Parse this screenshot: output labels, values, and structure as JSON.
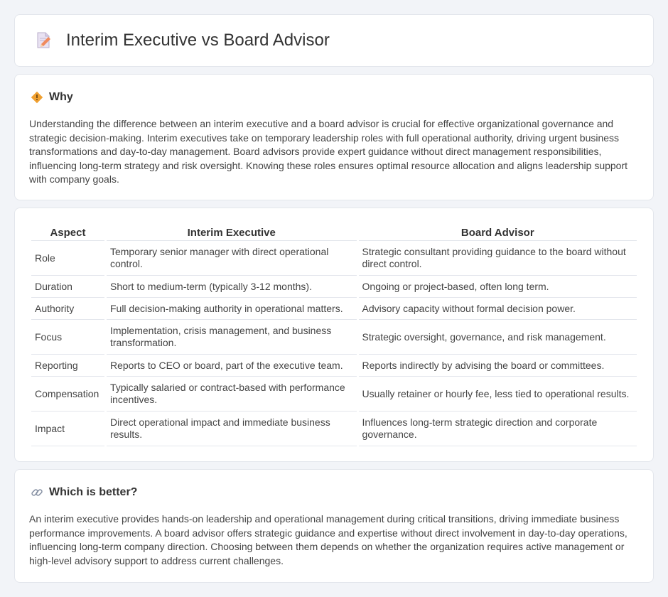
{
  "page": {
    "title": "Interim Executive vs Board Advisor",
    "title_icon": "document-pencil-icon"
  },
  "why": {
    "icon": "diamond-warning-icon",
    "title": "Why",
    "text": "Understanding the difference between an interim executive and a board advisor is crucial for effective organizational governance and strategic decision-making. Interim executives take on temporary leadership roles with full operational authority, driving urgent business transformations and day-to-day management. Board advisors provide expert guidance without direct management responsibilities, influencing long-term strategy and risk oversight. Knowing these roles ensures optimal resource allocation and aligns leadership support with company goals."
  },
  "comparison": {
    "headers": [
      "Aspect",
      "Interim Executive",
      "Board Advisor"
    ],
    "rows": [
      {
        "aspect": "Role",
        "interim": "Temporary senior manager with direct operational control.",
        "board": "Strategic consultant providing guidance to the board without direct control."
      },
      {
        "aspect": "Duration",
        "interim": "Short to medium-term (typically 3-12 months).",
        "board": "Ongoing or project-based, often long term."
      },
      {
        "aspect": "Authority",
        "interim": "Full decision-making authority in operational matters.",
        "board": "Advisory capacity without formal decision power."
      },
      {
        "aspect": "Focus",
        "interim": "Implementation, crisis management, and business transformation.",
        "board": "Strategic oversight, governance, and risk management."
      },
      {
        "aspect": "Reporting",
        "interim": "Reports to CEO or board, part of the executive team.",
        "board": "Reports indirectly by advising the board or committees."
      },
      {
        "aspect": "Compensation",
        "interim": "Typically salaried or contract-based with performance incentives.",
        "board": "Usually retainer or hourly fee, less tied to operational results."
      },
      {
        "aspect": "Impact",
        "interim": "Direct operational impact and immediate business results.",
        "board": "Influences long-term strategic direction and corporate governance."
      }
    ]
  },
  "better": {
    "icon": "link-icon",
    "title": "Which is better?",
    "text": "An interim executive provides hands-on leadership and operational management during critical transitions, driving immediate business performance improvements. A board advisor offers strategic guidance and expertise without direct involvement in day-to-day operations, influencing long-term company direction. Choosing between them depends on whether the organization requires active management or high-level advisory support to address current challenges."
  },
  "colors": {
    "background": "#f2f4f8",
    "card": "#ffffff",
    "border": "#e3e6ec",
    "accent_orange": "#f0a030"
  }
}
